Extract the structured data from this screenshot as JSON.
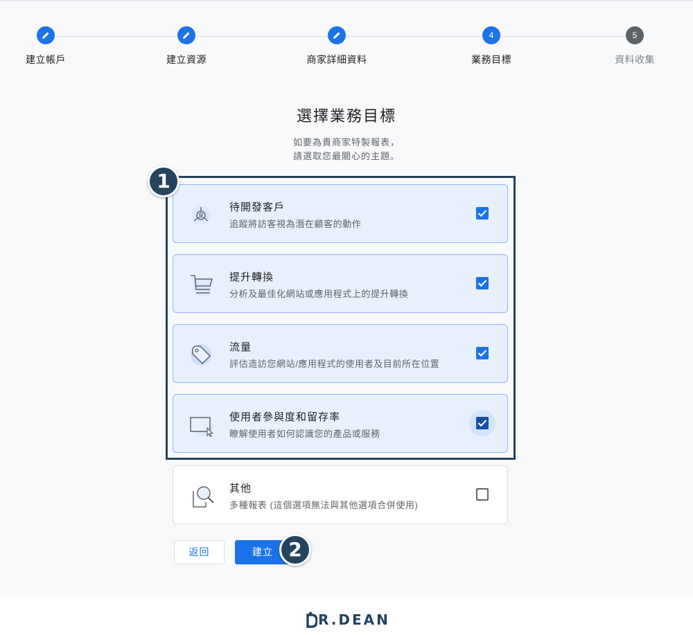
{
  "stepper": {
    "steps": [
      {
        "label": "建立帳戶",
        "status": "done",
        "number": ""
      },
      {
        "label": "建立資源",
        "status": "done",
        "number": ""
      },
      {
        "label": "商家詳細資料",
        "status": "done",
        "number": ""
      },
      {
        "label": "業務目標",
        "status": "current",
        "number": "4"
      },
      {
        "label": "資料收集",
        "status": "pending",
        "number": "5"
      }
    ]
  },
  "page": {
    "title": "選擇業務目標",
    "subtitle_line1": "如要為貴商家特製報表，",
    "subtitle_line2": "請選取您最關心的主題。"
  },
  "options": [
    {
      "title": "待開發客戶",
      "desc": "追蹤將訪客視為潛在顧客的動作",
      "checked": true,
      "icon": "target-person-icon"
    },
    {
      "title": "提升轉換",
      "desc": "分析及最佳化網站或應用程式上的提升轉換",
      "checked": true,
      "icon": "shopping-cart-icon"
    },
    {
      "title": "流量",
      "desc": "評估造訪您網站/應用程式的使用者及目前所在位置",
      "checked": true,
      "icon": "tag-icon"
    },
    {
      "title": "使用者參與度和留存率",
      "desc": "瞭解使用者如何認識您的產品或服務",
      "checked": true,
      "icon": "screen-cursor-icon"
    },
    {
      "title": "其他",
      "desc": "多種報表 (這個選項無法與其他選項合併使用)",
      "checked": false,
      "icon": "magnifier-report-icon"
    }
  ],
  "buttons": {
    "back": "返回",
    "create": "建立"
  },
  "annotations": {
    "badge_1": "1",
    "badge_2": "2"
  },
  "footer": {
    "logo_text": "R.DEAN"
  },
  "colors": {
    "primary": "#1a73e8",
    "selected_bg": "#e8f0fe",
    "frame": "#24435e"
  }
}
